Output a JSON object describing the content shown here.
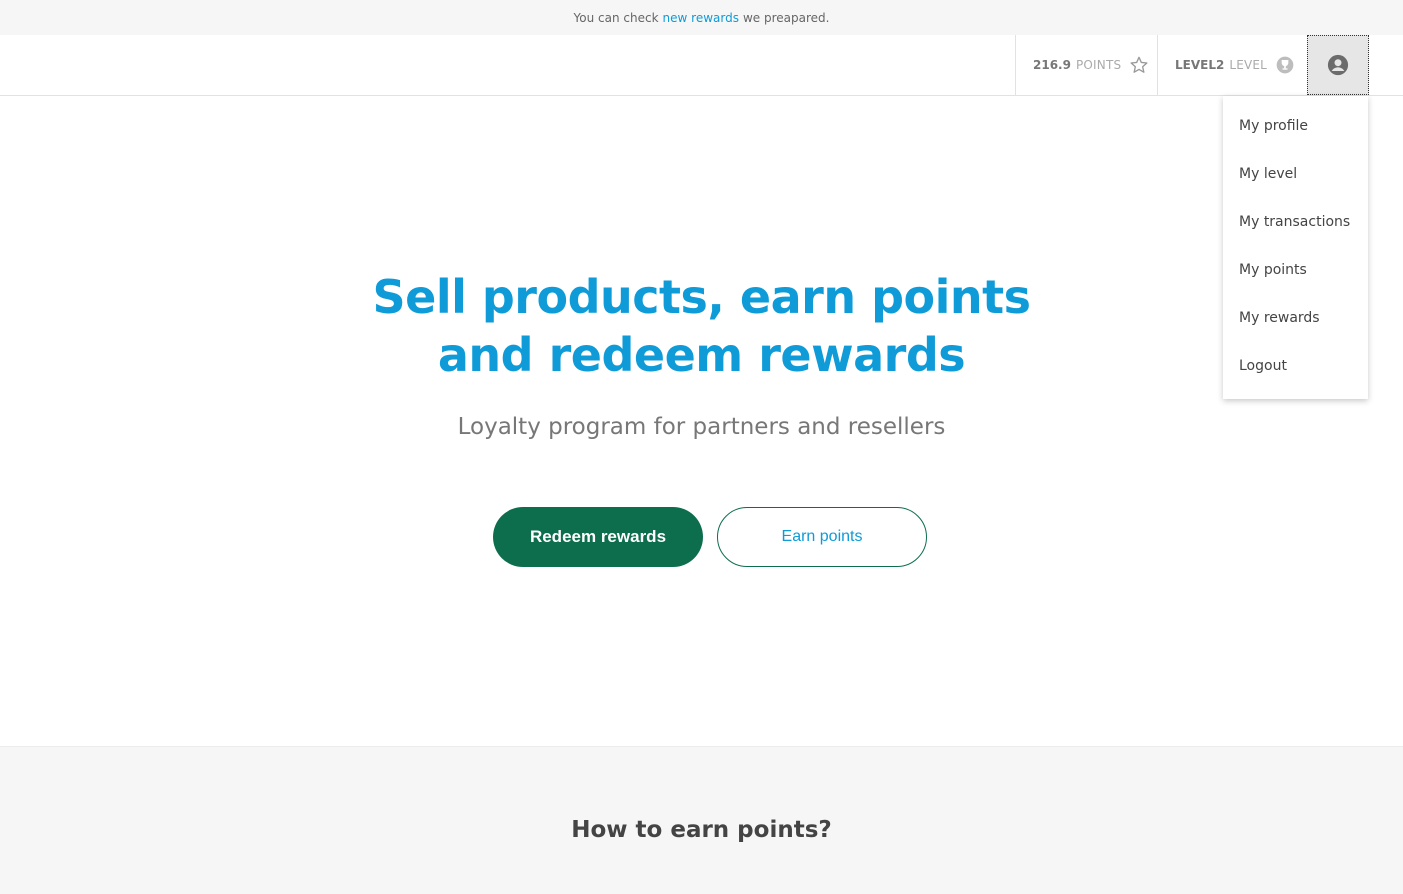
{
  "announcement": {
    "prefix": "You can check",
    "link": "new rewards",
    "suffix": "we preapared."
  },
  "header": {
    "points_value": "216.9",
    "points_unit": "POINTS",
    "level_value": "LEVEL2",
    "level_unit": "LEVEL",
    "icons": {
      "points": "star-icon",
      "level": "trophy-icon",
      "profile": "user-circle-icon"
    }
  },
  "profile_menu": {
    "items": [
      {
        "label": "My profile"
      },
      {
        "label": "My level"
      },
      {
        "label": "My transactions"
      },
      {
        "label": "My points"
      },
      {
        "label": "My rewards"
      },
      {
        "label": "Logout"
      }
    ]
  },
  "hero": {
    "title_line1": "Sell products, earn points",
    "title_line2": "and redeem rewards",
    "subtitle": "Loyalty program for partners and resellers",
    "primary_button": "Redeem rewards",
    "secondary_button": "Earn points"
  },
  "earn_section": {
    "title": "How to earn points?"
  },
  "colors": {
    "accent": "#0e9bd8",
    "brand_green": "#0d6e4e",
    "band_bg": "#f6f6f6"
  }
}
